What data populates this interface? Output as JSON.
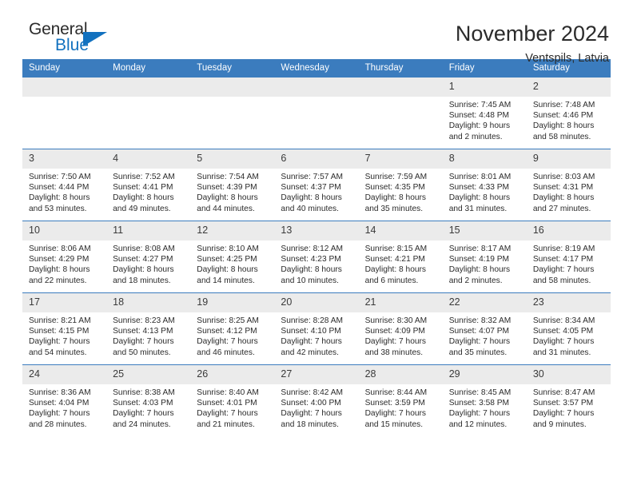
{
  "brand": {
    "name_part1": "General",
    "name_part2": "Blue",
    "accent_color": "#1271bf"
  },
  "header": {
    "title": "November 2024",
    "subtitle": "Ventspils, Latvia"
  },
  "theme": {
    "header_row_color": "#3b7cbe",
    "daynum_band_color": "#ebebeb",
    "text_color": "#2b2b2b"
  },
  "columns": [
    "Sunday",
    "Monday",
    "Tuesday",
    "Wednesday",
    "Thursday",
    "Friday",
    "Saturday"
  ],
  "weeks": [
    [
      {
        "day": "",
        "empty": true,
        "sunrise": "",
        "sunset": "",
        "daylight1": "",
        "daylight2": ""
      },
      {
        "day": "",
        "empty": true,
        "sunrise": "",
        "sunset": "",
        "daylight1": "",
        "daylight2": ""
      },
      {
        "day": "",
        "empty": true,
        "sunrise": "",
        "sunset": "",
        "daylight1": "",
        "daylight2": ""
      },
      {
        "day": "",
        "empty": true,
        "sunrise": "",
        "sunset": "",
        "daylight1": "",
        "daylight2": ""
      },
      {
        "day": "",
        "empty": true,
        "sunrise": "",
        "sunset": "",
        "daylight1": "",
        "daylight2": ""
      },
      {
        "day": "1",
        "empty": false,
        "sunrise": "Sunrise: 7:45 AM",
        "sunset": "Sunset: 4:48 PM",
        "daylight1": "Daylight: 9 hours",
        "daylight2": "and 2 minutes."
      },
      {
        "day": "2",
        "empty": false,
        "sunrise": "Sunrise: 7:48 AM",
        "sunset": "Sunset: 4:46 PM",
        "daylight1": "Daylight: 8 hours",
        "daylight2": "and 58 minutes."
      }
    ],
    [
      {
        "day": "3",
        "empty": false,
        "sunrise": "Sunrise: 7:50 AM",
        "sunset": "Sunset: 4:44 PM",
        "daylight1": "Daylight: 8 hours",
        "daylight2": "and 53 minutes."
      },
      {
        "day": "4",
        "empty": false,
        "sunrise": "Sunrise: 7:52 AM",
        "sunset": "Sunset: 4:41 PM",
        "daylight1": "Daylight: 8 hours",
        "daylight2": "and 49 minutes."
      },
      {
        "day": "5",
        "empty": false,
        "sunrise": "Sunrise: 7:54 AM",
        "sunset": "Sunset: 4:39 PM",
        "daylight1": "Daylight: 8 hours",
        "daylight2": "and 44 minutes."
      },
      {
        "day": "6",
        "empty": false,
        "sunrise": "Sunrise: 7:57 AM",
        "sunset": "Sunset: 4:37 PM",
        "daylight1": "Daylight: 8 hours",
        "daylight2": "and 40 minutes."
      },
      {
        "day": "7",
        "empty": false,
        "sunrise": "Sunrise: 7:59 AM",
        "sunset": "Sunset: 4:35 PM",
        "daylight1": "Daylight: 8 hours",
        "daylight2": "and 35 minutes."
      },
      {
        "day": "8",
        "empty": false,
        "sunrise": "Sunrise: 8:01 AM",
        "sunset": "Sunset: 4:33 PM",
        "daylight1": "Daylight: 8 hours",
        "daylight2": "and 31 minutes."
      },
      {
        "day": "9",
        "empty": false,
        "sunrise": "Sunrise: 8:03 AM",
        "sunset": "Sunset: 4:31 PM",
        "daylight1": "Daylight: 8 hours",
        "daylight2": "and 27 minutes."
      }
    ],
    [
      {
        "day": "10",
        "empty": false,
        "sunrise": "Sunrise: 8:06 AM",
        "sunset": "Sunset: 4:29 PM",
        "daylight1": "Daylight: 8 hours",
        "daylight2": "and 22 minutes."
      },
      {
        "day": "11",
        "empty": false,
        "sunrise": "Sunrise: 8:08 AM",
        "sunset": "Sunset: 4:27 PM",
        "daylight1": "Daylight: 8 hours",
        "daylight2": "and 18 minutes."
      },
      {
        "day": "12",
        "empty": false,
        "sunrise": "Sunrise: 8:10 AM",
        "sunset": "Sunset: 4:25 PM",
        "daylight1": "Daylight: 8 hours",
        "daylight2": "and 14 minutes."
      },
      {
        "day": "13",
        "empty": false,
        "sunrise": "Sunrise: 8:12 AM",
        "sunset": "Sunset: 4:23 PM",
        "daylight1": "Daylight: 8 hours",
        "daylight2": "and 10 minutes."
      },
      {
        "day": "14",
        "empty": false,
        "sunrise": "Sunrise: 8:15 AM",
        "sunset": "Sunset: 4:21 PM",
        "daylight1": "Daylight: 8 hours",
        "daylight2": "and 6 minutes."
      },
      {
        "day": "15",
        "empty": false,
        "sunrise": "Sunrise: 8:17 AM",
        "sunset": "Sunset: 4:19 PM",
        "daylight1": "Daylight: 8 hours",
        "daylight2": "and 2 minutes."
      },
      {
        "day": "16",
        "empty": false,
        "sunrise": "Sunrise: 8:19 AM",
        "sunset": "Sunset: 4:17 PM",
        "daylight1": "Daylight: 7 hours",
        "daylight2": "and 58 minutes."
      }
    ],
    [
      {
        "day": "17",
        "empty": false,
        "sunrise": "Sunrise: 8:21 AM",
        "sunset": "Sunset: 4:15 PM",
        "daylight1": "Daylight: 7 hours",
        "daylight2": "and 54 minutes."
      },
      {
        "day": "18",
        "empty": false,
        "sunrise": "Sunrise: 8:23 AM",
        "sunset": "Sunset: 4:13 PM",
        "daylight1": "Daylight: 7 hours",
        "daylight2": "and 50 minutes."
      },
      {
        "day": "19",
        "empty": false,
        "sunrise": "Sunrise: 8:25 AM",
        "sunset": "Sunset: 4:12 PM",
        "daylight1": "Daylight: 7 hours",
        "daylight2": "and 46 minutes."
      },
      {
        "day": "20",
        "empty": false,
        "sunrise": "Sunrise: 8:28 AM",
        "sunset": "Sunset: 4:10 PM",
        "daylight1": "Daylight: 7 hours",
        "daylight2": "and 42 minutes."
      },
      {
        "day": "21",
        "empty": false,
        "sunrise": "Sunrise: 8:30 AM",
        "sunset": "Sunset: 4:09 PM",
        "daylight1": "Daylight: 7 hours",
        "daylight2": "and 38 minutes."
      },
      {
        "day": "22",
        "empty": false,
        "sunrise": "Sunrise: 8:32 AM",
        "sunset": "Sunset: 4:07 PM",
        "daylight1": "Daylight: 7 hours",
        "daylight2": "and 35 minutes."
      },
      {
        "day": "23",
        "empty": false,
        "sunrise": "Sunrise: 8:34 AM",
        "sunset": "Sunset: 4:05 PM",
        "daylight1": "Daylight: 7 hours",
        "daylight2": "and 31 minutes."
      }
    ],
    [
      {
        "day": "24",
        "empty": false,
        "sunrise": "Sunrise: 8:36 AM",
        "sunset": "Sunset: 4:04 PM",
        "daylight1": "Daylight: 7 hours",
        "daylight2": "and 28 minutes."
      },
      {
        "day": "25",
        "empty": false,
        "sunrise": "Sunrise: 8:38 AM",
        "sunset": "Sunset: 4:03 PM",
        "daylight1": "Daylight: 7 hours",
        "daylight2": "and 24 minutes."
      },
      {
        "day": "26",
        "empty": false,
        "sunrise": "Sunrise: 8:40 AM",
        "sunset": "Sunset: 4:01 PM",
        "daylight1": "Daylight: 7 hours",
        "daylight2": "and 21 minutes."
      },
      {
        "day": "27",
        "empty": false,
        "sunrise": "Sunrise: 8:42 AM",
        "sunset": "Sunset: 4:00 PM",
        "daylight1": "Daylight: 7 hours",
        "daylight2": "and 18 minutes."
      },
      {
        "day": "28",
        "empty": false,
        "sunrise": "Sunrise: 8:44 AM",
        "sunset": "Sunset: 3:59 PM",
        "daylight1": "Daylight: 7 hours",
        "daylight2": "and 15 minutes."
      },
      {
        "day": "29",
        "empty": false,
        "sunrise": "Sunrise: 8:45 AM",
        "sunset": "Sunset: 3:58 PM",
        "daylight1": "Daylight: 7 hours",
        "daylight2": "and 12 minutes."
      },
      {
        "day": "30",
        "empty": false,
        "sunrise": "Sunrise: 8:47 AM",
        "sunset": "Sunset: 3:57 PM",
        "daylight1": "Daylight: 7 hours",
        "daylight2": "and 9 minutes."
      }
    ]
  ]
}
